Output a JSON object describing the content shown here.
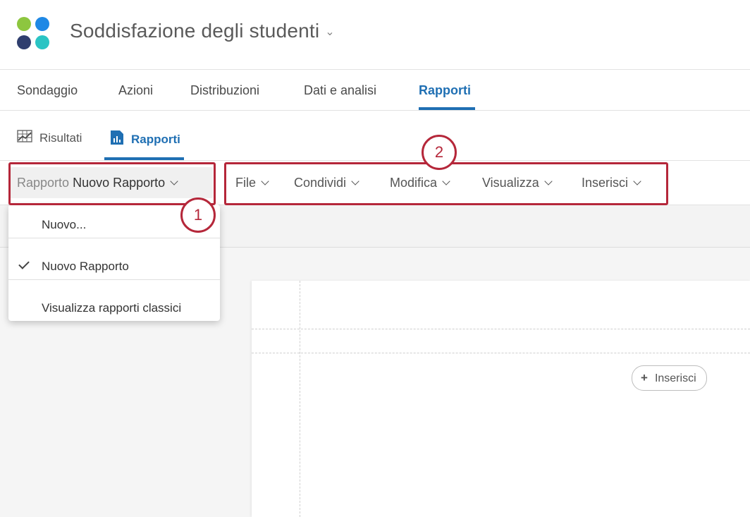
{
  "header": {
    "title": "Soddisfazione degli studenti",
    "logo_colors": [
      "#8dc63f",
      "#1e88e5",
      "#2f3e6e",
      "#2ac4c4"
    ]
  },
  "main_tabs": [
    {
      "label": "Sondaggio"
    },
    {
      "label": "Azioni"
    },
    {
      "label": "Distribuzioni"
    },
    {
      "label": "Dati e analisi"
    },
    {
      "label": "Rapporti",
      "active": true
    }
  ],
  "sub_tabs": [
    {
      "label": "Risultati",
      "icon": "results-chart-icon"
    },
    {
      "label": "Rapporti",
      "icon": "report-bar-chart-icon",
      "active": true
    }
  ],
  "toolbar": {
    "report_prefix": "Rapporto",
    "report_name": "Nuovo Rapporto",
    "menus": [
      "File",
      "Condividi",
      "Modifica",
      "Visualizza",
      "Inserisci"
    ]
  },
  "dropdown": {
    "items": [
      {
        "label": "Nuovo..."
      },
      {
        "label": "Nuovo Rapporto",
        "checked": true
      },
      {
        "label": "Visualizza rapporti classici"
      }
    ]
  },
  "canvas": {
    "insert_label": "Inserisci"
  },
  "callouts": [
    "1",
    "2"
  ],
  "colors": {
    "accent": "#1f6fb3",
    "highlight": "#b5273a"
  }
}
